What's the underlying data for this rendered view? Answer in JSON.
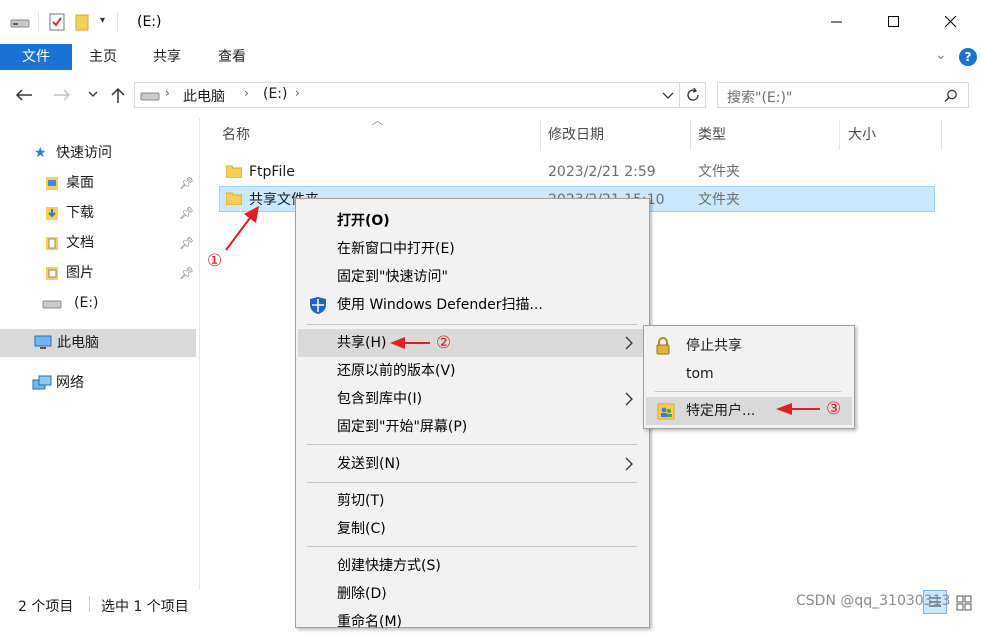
{
  "window": {
    "title": "(E:)",
    "controls": [
      "minimize",
      "maximize",
      "close"
    ]
  },
  "ribbon": {
    "tabs": [
      "文件",
      "主页",
      "共享",
      "查看"
    ],
    "help": "?"
  },
  "address": {
    "crumbs": [
      "此电脑",
      "(E:)"
    ],
    "search_placeholder": "搜索\"(E:)\""
  },
  "nav": {
    "quick_access": "快速访问",
    "items": [
      {
        "label": "桌面",
        "pinned": true
      },
      {
        "label": "下载",
        "pinned": true
      },
      {
        "label": "文档",
        "pinned": true
      },
      {
        "label": "图片",
        "pinned": true
      },
      {
        "label": "(E:)",
        "pinned": false
      }
    ],
    "this_pc": "此电脑",
    "network": "网络"
  },
  "columns": {
    "name": "名称",
    "modified": "修改日期",
    "type": "类型",
    "size": "大小"
  },
  "files": [
    {
      "name": "FtpFile",
      "modified": "2023/2/21 2:59",
      "type": "文件夹",
      "selected": false
    },
    {
      "name": "共享文件夹",
      "modified": "2023/2/21 15:10",
      "type": "文件夹",
      "selected": true
    }
  ],
  "context_menu": {
    "open": "打开(O)",
    "open_new_window": "在新窗口中打开(E)",
    "pin_quick_access": "固定到\"快速访问\"",
    "defender": "使用 Windows Defender扫描...",
    "share": "共享(H)",
    "restore": "还原以前的版本(V)",
    "include_library": "包含到库中(I)",
    "pin_start": "固定到\"开始\"屏幕(P)",
    "send_to": "发送到(N)",
    "cut": "剪切(T)",
    "copy": "复制(C)",
    "create_shortcut": "创建快捷方式(S)",
    "delete": "删除(D)",
    "rename": "重命名(M)"
  },
  "share_submenu": {
    "stop_sharing": "停止共享",
    "user": "tom",
    "specific_people": "特定用户..."
  },
  "annotations": [
    "①",
    "②",
    "③"
  ],
  "status": {
    "count": "2 个项目",
    "selected": "选中 1 个项目"
  },
  "watermark": "CSDN @qq_31030313",
  "colors": {
    "accent": "#1a73d2",
    "selection": "#cce8ff",
    "menu_bg": "#f2f2f2",
    "menu_hover": "#d9d9d9",
    "annotation": "#e02020"
  }
}
